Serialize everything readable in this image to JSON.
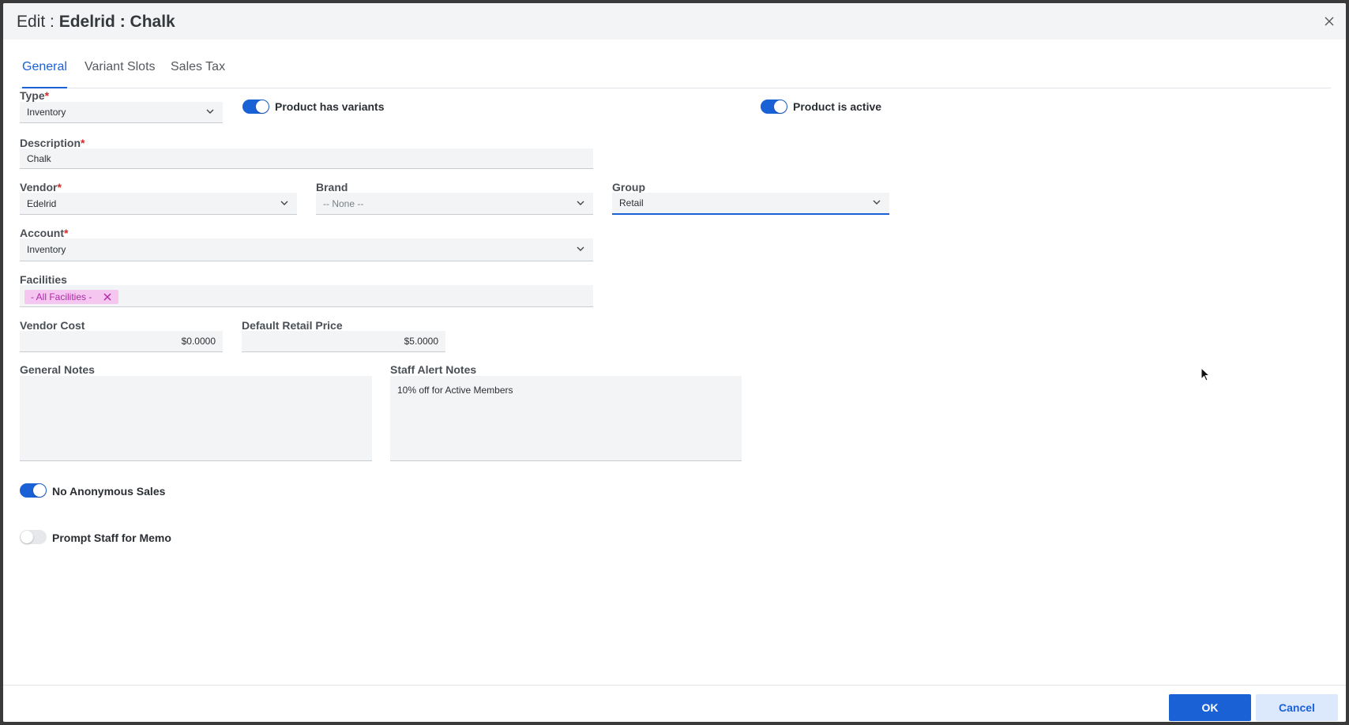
{
  "dialog": {
    "title_prefix": "Edit : ",
    "title_entity": "Edelrid : Chalk"
  },
  "tabs": [
    {
      "label": "General",
      "active": true
    },
    {
      "label": "Variant Slots",
      "active": false
    },
    {
      "label": "Sales Tax",
      "active": false
    }
  ],
  "form": {
    "type": {
      "label": "Type",
      "required_mark": "*",
      "value": "Inventory"
    },
    "has_variants": {
      "label": "Product has variants",
      "on": true
    },
    "is_active": {
      "label": "Product is active",
      "on": true
    },
    "description": {
      "label": "Description",
      "required_mark": "*",
      "value": "Chalk"
    },
    "vendor": {
      "label": "Vendor",
      "required_mark": "*",
      "value": "Edelrid"
    },
    "brand": {
      "label": "Brand",
      "value": "-- None --"
    },
    "group": {
      "label": "Group",
      "value": "Retail"
    },
    "account": {
      "label": "Account",
      "required_mark": "*",
      "value": "Inventory"
    },
    "facilities": {
      "label": "Facilities",
      "chip": "- All Facilities -"
    },
    "vendor_cost": {
      "label": "Vendor Cost",
      "value": "$0.0000"
    },
    "retail_price": {
      "label": "Default Retail Price",
      "value": "$5.0000"
    },
    "general_notes": {
      "label": "General Notes",
      "value": ""
    },
    "staff_alert_notes": {
      "label": "Staff Alert Notes",
      "value": "10% off for Active Members"
    },
    "no_anonymous_sales": {
      "label": "No Anonymous Sales",
      "on": true
    },
    "prompt_staff_memo": {
      "label": "Prompt Staff for Memo",
      "on": false
    }
  },
  "footer": {
    "ok_label": "OK",
    "cancel_label": "Cancel"
  },
  "colors": {
    "accent": "#1a61d6",
    "chip_bg": "#f5c6f0",
    "chip_text": "#b02aa8",
    "required": "#d62a2a"
  }
}
